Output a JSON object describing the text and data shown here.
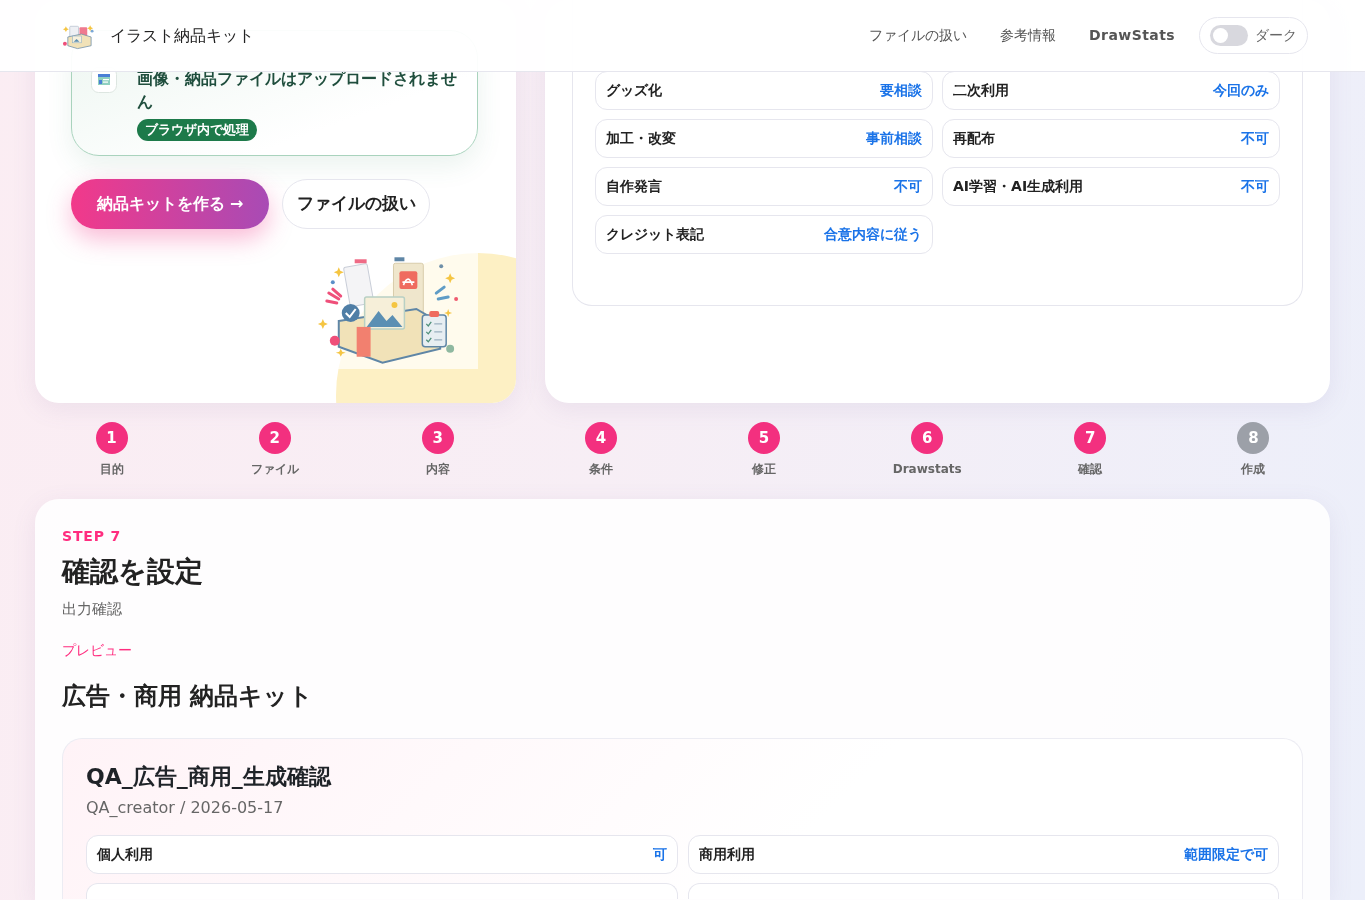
{
  "header": {
    "title": "イラスト納品キット",
    "nav": [
      {
        "label": "ファイルの扱い",
        "kind": "link"
      },
      {
        "label": "参考情報",
        "kind": "link"
      },
      {
        "label": "DrawStats",
        "kind": "stats"
      }
    ],
    "theme_toggle": {
      "label": "ダーク",
      "on": false
    }
  },
  "intro_card": {
    "notice": {
      "text": "画像・納品ファイルはアップロードされません",
      "badge": "ブラウザ内で処理"
    },
    "buttons": [
      {
        "label": "納品キットを作る →",
        "kind": "primary"
      },
      {
        "label": "ファイルの扱い",
        "kind": "secondary"
      }
    ]
  },
  "terms_card": {
    "terms": [
      {
        "label": "グッズ化",
        "value": "要相談"
      },
      {
        "label": "二次利用",
        "value": "今回のみ"
      },
      {
        "label": "加工・改変",
        "value": "事前相談"
      },
      {
        "label": "再配布",
        "value": "不可"
      },
      {
        "label": "自作発言",
        "value": "不可"
      },
      {
        "label": "AI学習・AI生成利用",
        "value": "不可"
      },
      {
        "label": "クレジット表記",
        "value": "合意内容に従う"
      }
    ]
  },
  "steps": [
    {
      "number": "1",
      "label": "目的",
      "reached": true
    },
    {
      "number": "2",
      "label": "ファイル",
      "reached": true
    },
    {
      "number": "3",
      "label": "内容",
      "reached": true
    },
    {
      "number": "4",
      "label": "条件",
      "reached": true
    },
    {
      "number": "5",
      "label": "修正",
      "reached": true
    },
    {
      "number": "6",
      "label": "Drawstats",
      "reached": true
    },
    {
      "number": "7",
      "label": "確認",
      "reached": true
    },
    {
      "number": "8",
      "label": "作成",
      "reached": false
    }
  ],
  "step_section": {
    "eyebrow": "STEP 7",
    "title": "確認を設定",
    "subtitle": "出力確認",
    "preview_label": "プレビュー",
    "kit_title": "広告・商用 納品キット",
    "preview": {
      "title": "QA_広告_商用_生成確認",
      "meta": "QA_creator / 2026-05-17",
      "terms": [
        {
          "kind": "term",
          "label": "個人利用",
          "value": "可"
        },
        {
          "kind": "term",
          "label": "商用利用",
          "value": "範囲限定で可"
        },
        {
          "kind": "cut_off"
        },
        {
          "kind": "cut_off"
        }
      ]
    }
  }
}
